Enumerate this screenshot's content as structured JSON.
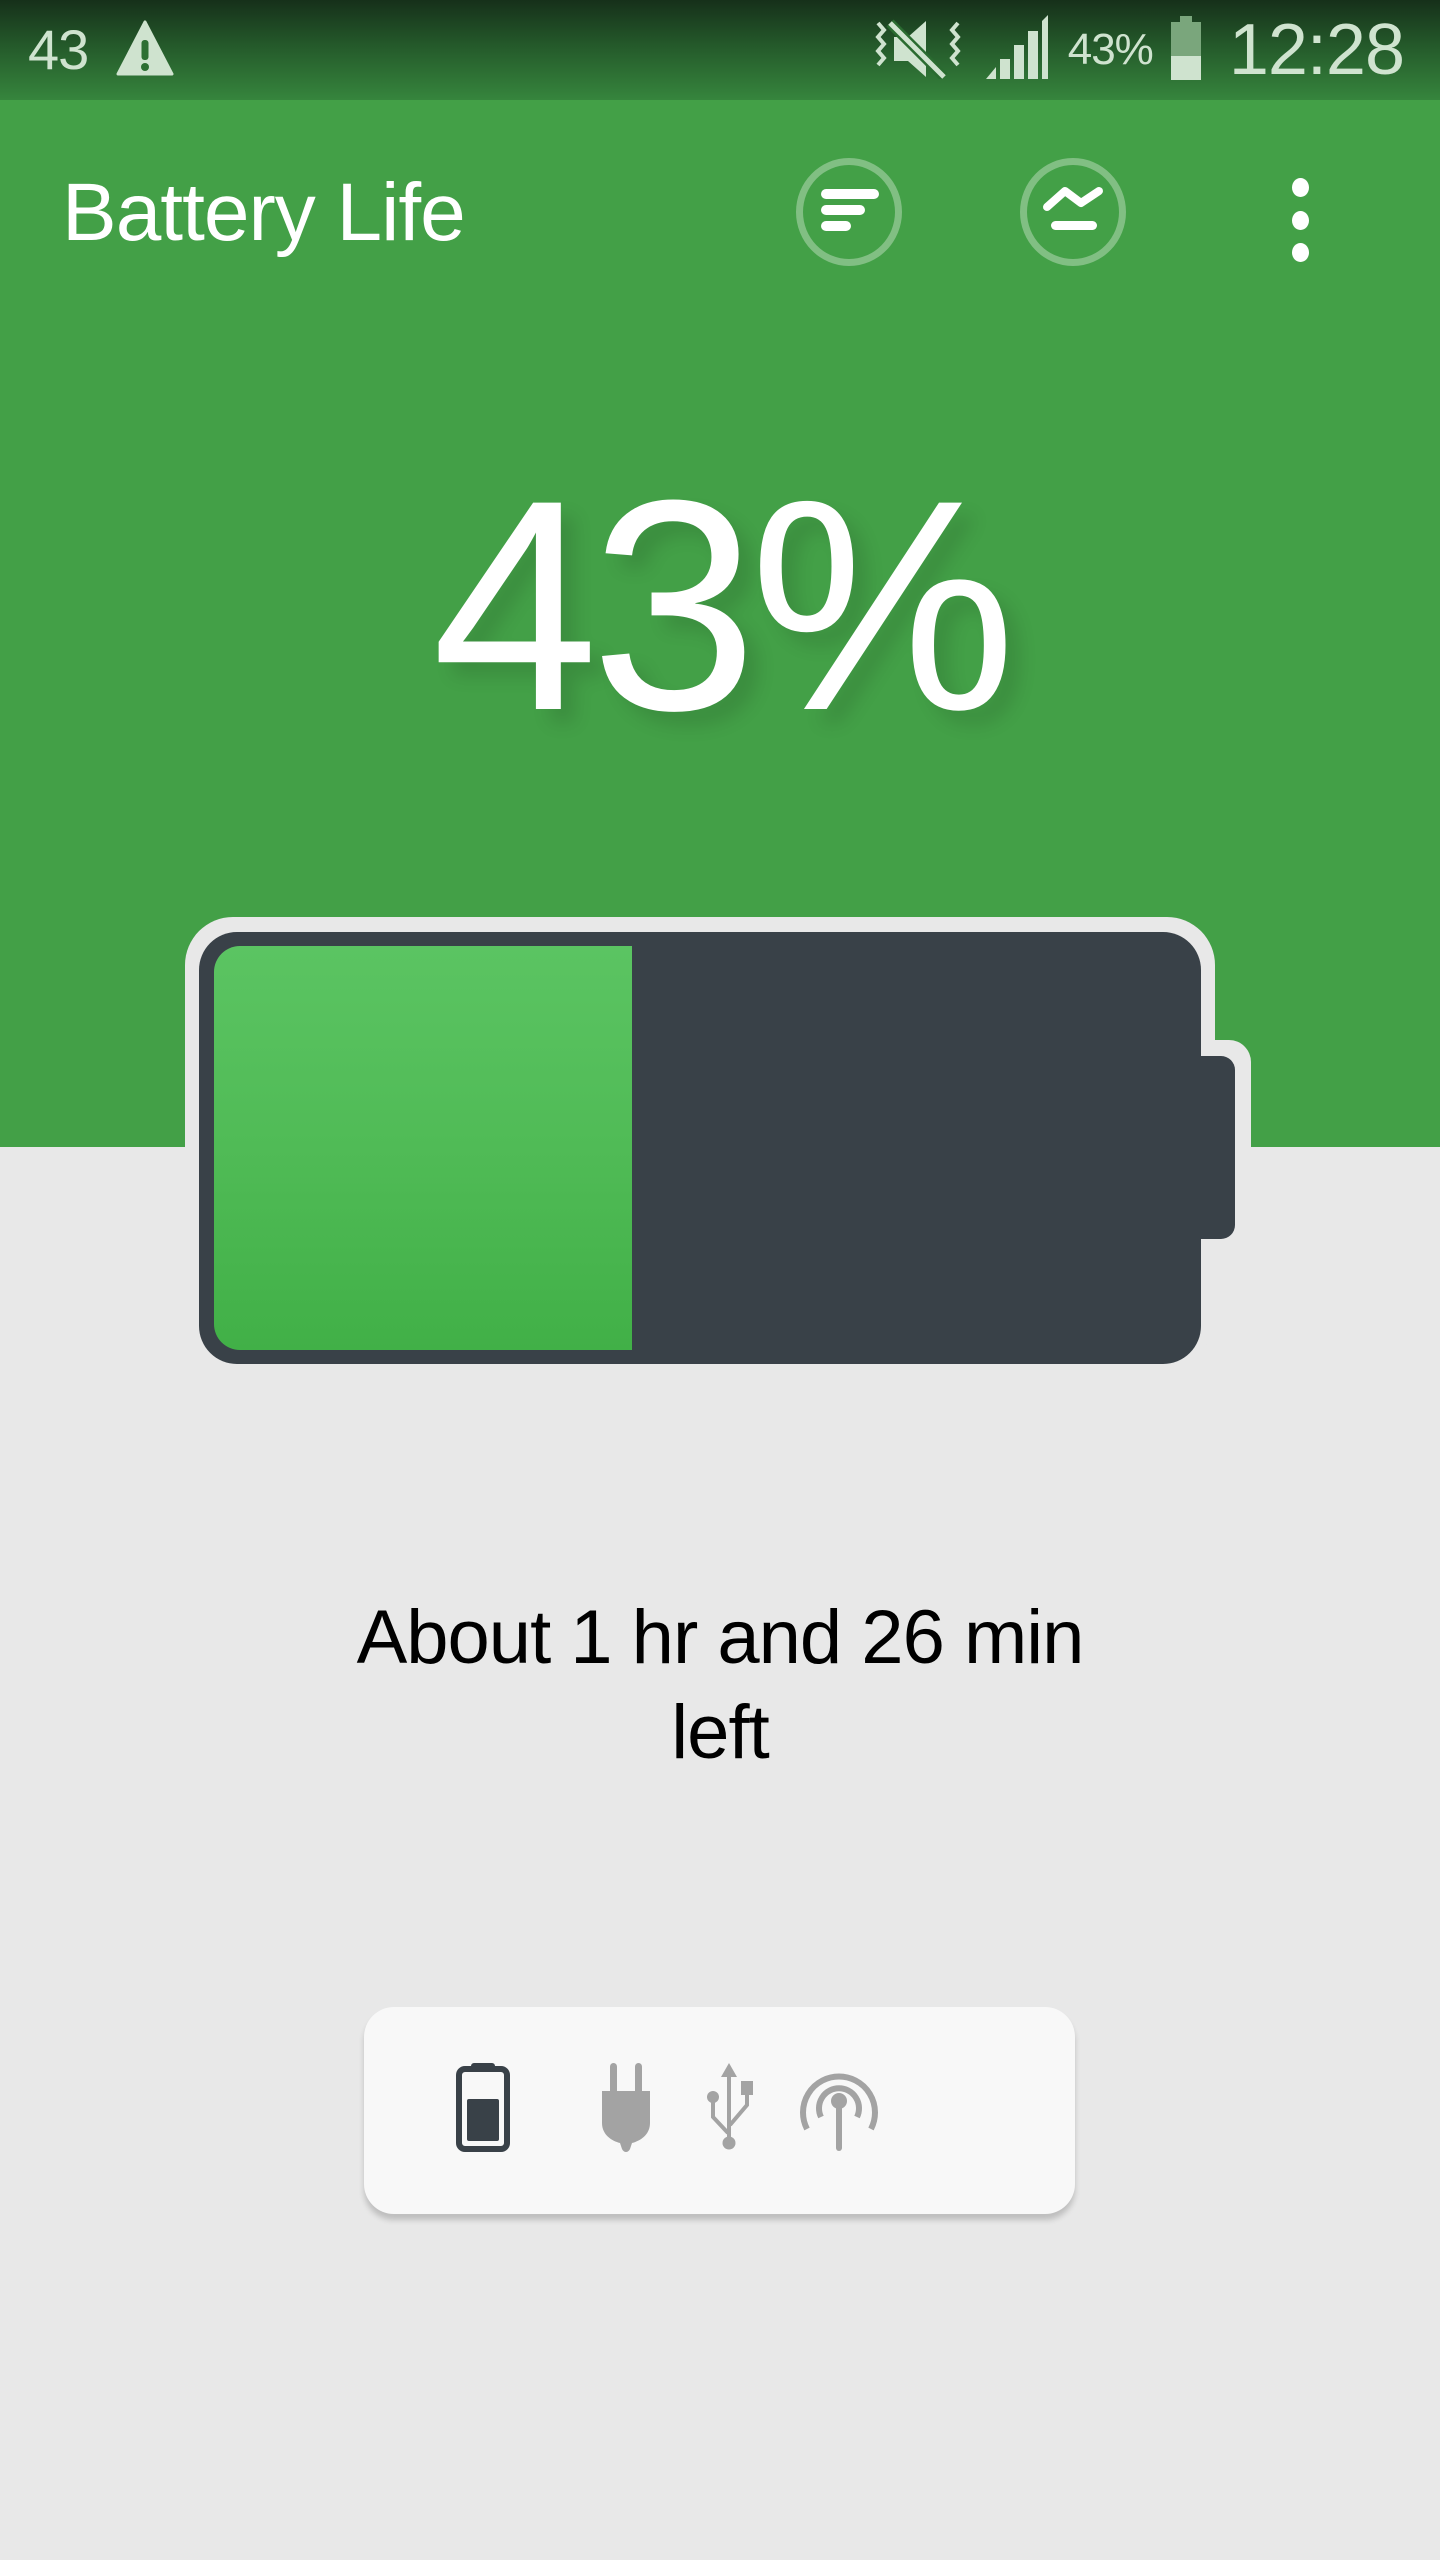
{
  "status_bar": {
    "notification_count": "43",
    "notification_icons": [
      "warning-icon"
    ],
    "system_icons": [
      "vibrate-mute-icon",
      "signal-icon"
    ],
    "battery_text": "43%",
    "battery_level": 0.43,
    "time": "12:28"
  },
  "app_bar": {
    "title": "Battery Life",
    "actions": [
      {
        "name": "filter-button",
        "icon": "filter-list-icon"
      },
      {
        "name": "stats-button",
        "icon": "chart-line-icon"
      },
      {
        "name": "more-options-button",
        "icon": "more-vert-icon"
      }
    ]
  },
  "main": {
    "percentage_text": "43%",
    "battery_level_percent": 43,
    "time_left_text": "About 1 hr and 26 min left"
  },
  "power_source_selector": {
    "items": [
      {
        "name": "battery",
        "icon": "battery-icon",
        "selected": true
      },
      {
        "name": "ac",
        "icon": "power-plug-icon",
        "selected": false
      },
      {
        "name": "usb",
        "icon": "usb-icon",
        "selected": false
      },
      {
        "name": "wireless",
        "icon": "wireless-icon",
        "selected": false
      }
    ]
  },
  "colors": {
    "primary_green": "#43a047",
    "battery_fill": "#4cb852",
    "battery_body": "#394148",
    "background": "#e8e8e8",
    "selected_icon": "#394148",
    "unselected_icon": "#a3a3a3"
  }
}
